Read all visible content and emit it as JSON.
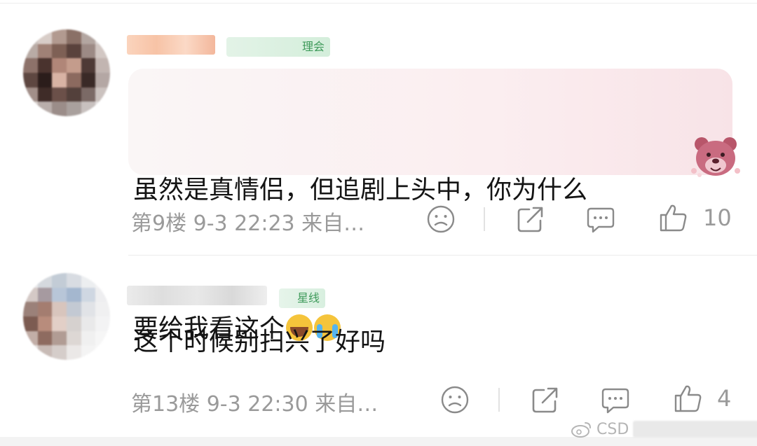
{
  "comments": [
    {
      "text_line1": "虽然是真情侣，但追剧上头中，你为什么",
      "text_line2": "要给我看这个",
      "emojis": [
        "crying-face-icon",
        "tearful-face-icon"
      ],
      "floor_time": "第9楼 9-3 22:23 来自…",
      "badge_text": "理会",
      "like_count": "10"
    },
    {
      "text": "这个时候别扫兴了好吗",
      "floor_time": "第13楼 9-3 22:30 来自…",
      "badge_text": "星线",
      "like_count": "4"
    }
  ],
  "icons": {
    "dislike": "sad-face-icon",
    "share": "share-icon",
    "reply": "comment-icon",
    "like": "thumbs-up-icon"
  },
  "watermark": {
    "prefix": "CSD"
  },
  "colors": {
    "meta_text": "#9a9a9a",
    "badge_green": "#3e9a5a",
    "bubble_pink": "#fbeef0"
  }
}
